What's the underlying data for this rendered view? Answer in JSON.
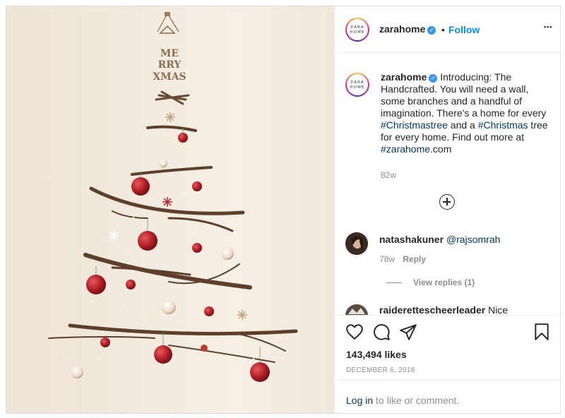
{
  "header": {
    "avatar_logo_line1": "ZARA",
    "avatar_logo_line2": "HOME",
    "username": "zarahome",
    "verified_mark": "✓",
    "separator": "•",
    "follow_label": "Follow",
    "more_label": "•••"
  },
  "caption": {
    "username": "zarahome",
    "part1": "Introducing: The Handcrafted. You will need a wall, some branches and a handful of imagination. There's a home for every ",
    "hashtag1": "#Christmastree",
    "part2": " and a ",
    "hashtag2": "#Christmas",
    "part3": " tree for every home. Find out more at ",
    "hashtag3": "#zarahome",
    "part4": ".com",
    "age": "82w"
  },
  "comments": [
    {
      "username": "natashakuner",
      "mention": "@rajsomrah",
      "age": "78w",
      "reply_label": "Reply",
      "view_replies": "View replies (1)"
    },
    {
      "username": "raiderettescheerleader",
      "text": "Nice"
    }
  ],
  "actions": {
    "like_icon": "heart-icon",
    "comment_icon": "comment-icon",
    "share_icon": "share-icon",
    "save_icon": "bookmark-icon"
  },
  "likes": "143,494 likes",
  "date": "DECEMBER 6, 2018",
  "login": {
    "link": "Log in",
    "suffix": " to like or comment."
  },
  "photo": {
    "sign_lines": [
      "ME",
      "RRY",
      "XMAS"
    ]
  },
  "colors": {
    "follow_blue": "#0095f6",
    "hashtag": "#00376b",
    "meta_gray": "#8e8e8e",
    "ornament_red": "#c0232c"
  }
}
